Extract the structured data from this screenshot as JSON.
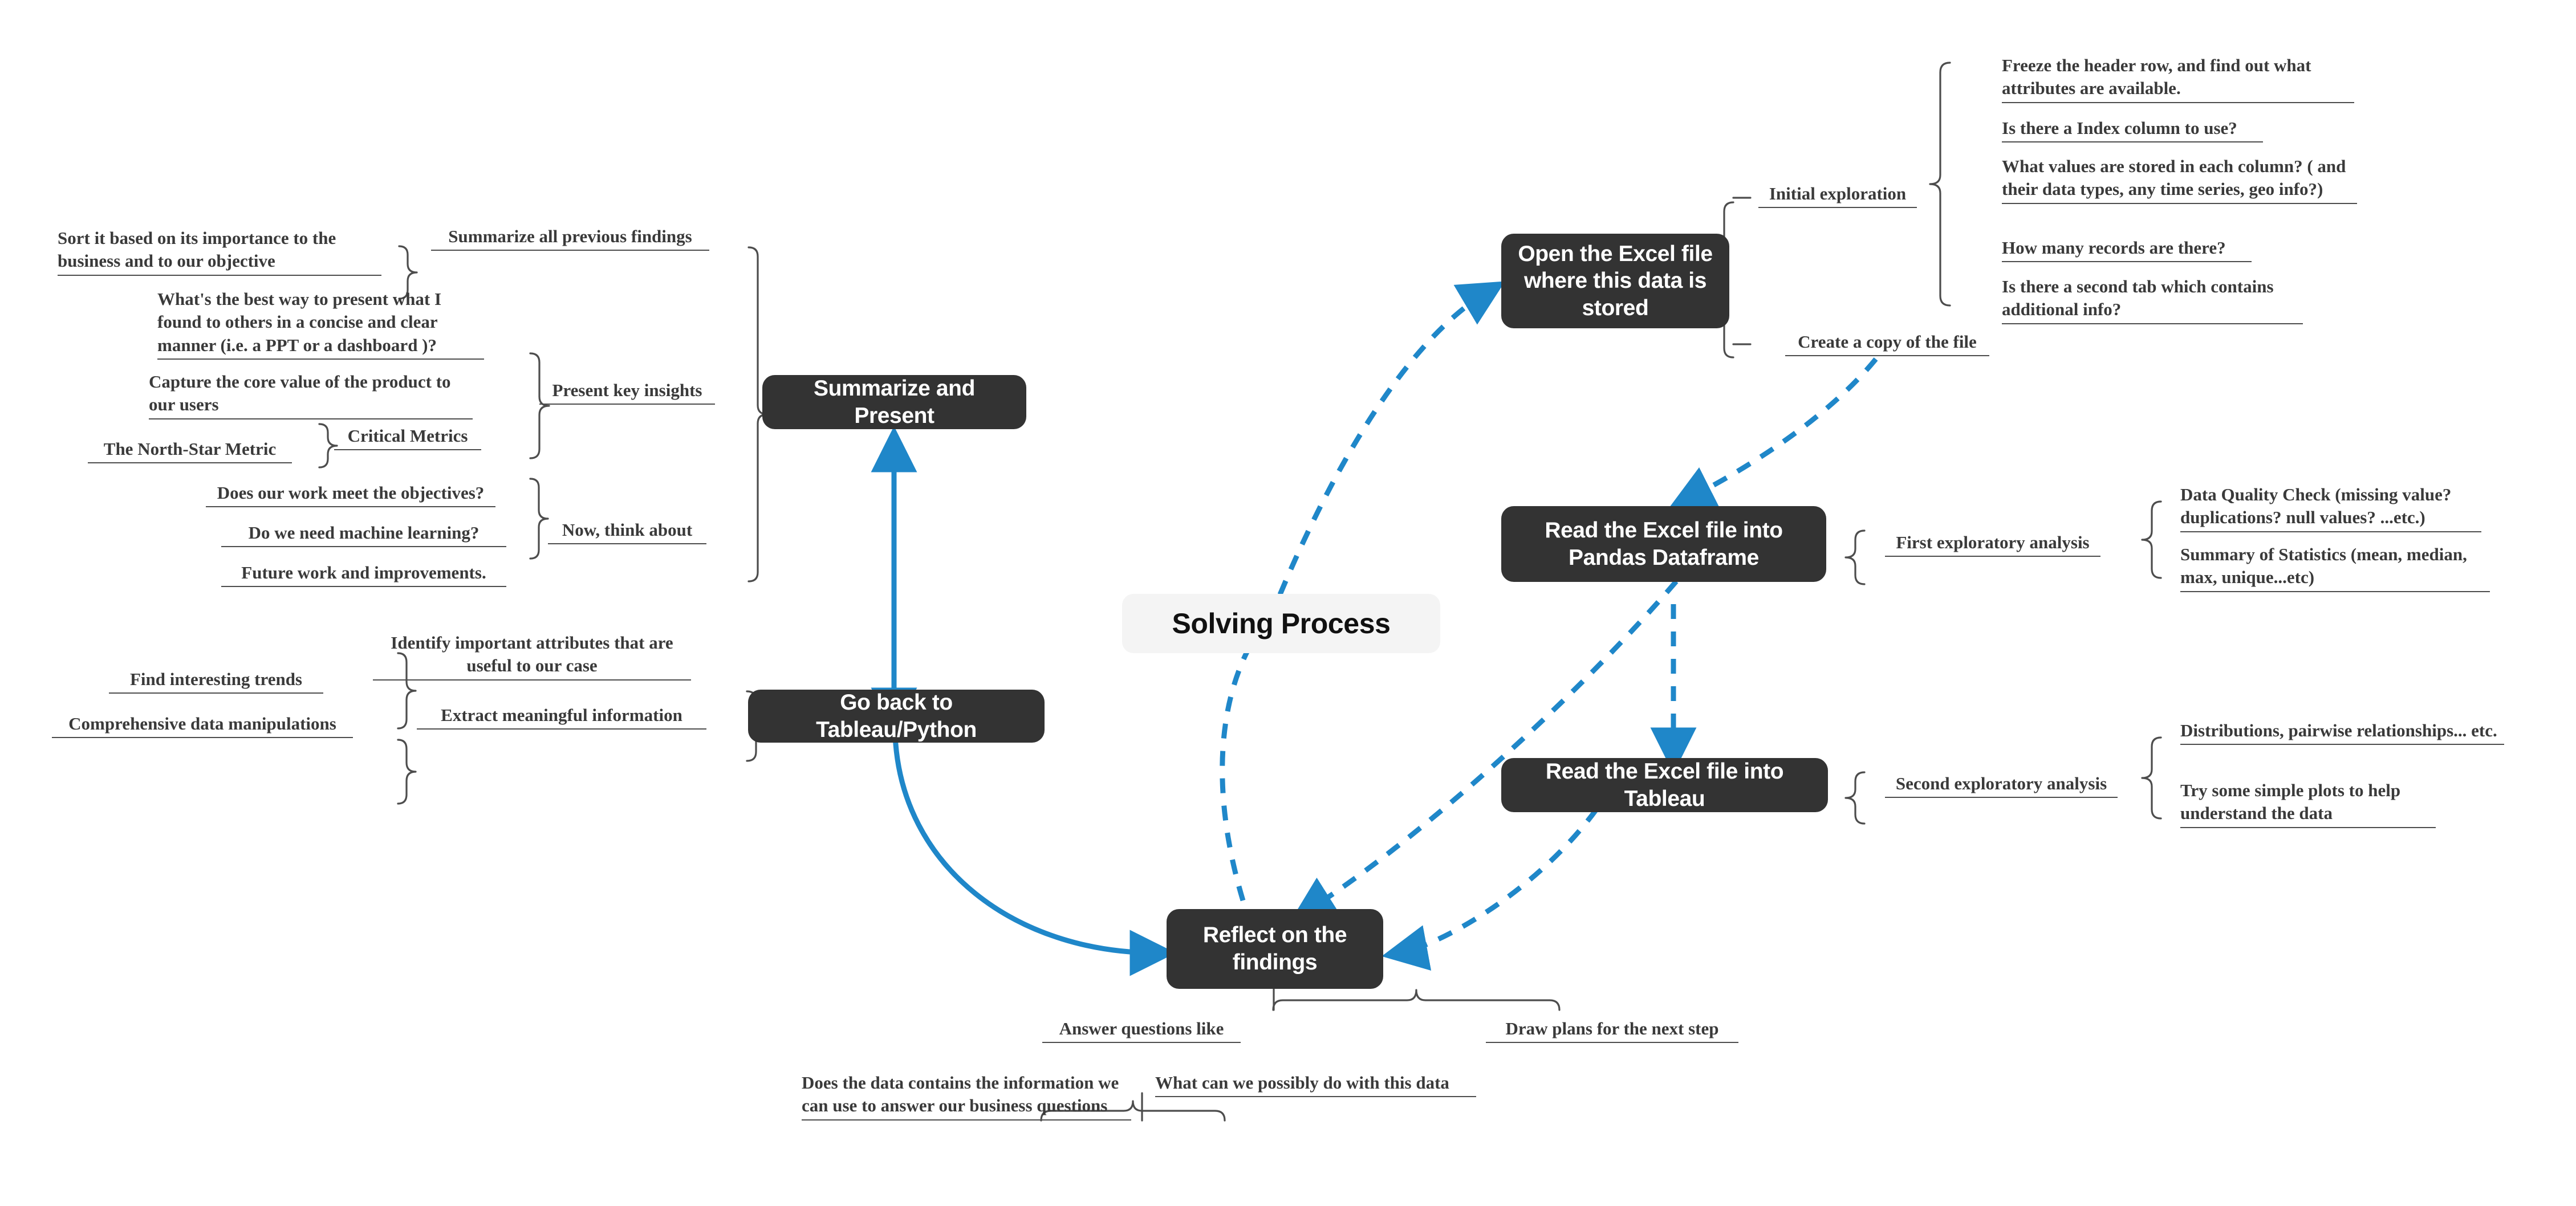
{
  "title": "Solving Process",
  "colors": {
    "node_fill": "#333333",
    "node_text": "#ffffff",
    "center_fill": "#f4f4f4",
    "center_text": "#111111",
    "accent_arrow": "#1f87c9",
    "line": "#4d4d4d",
    "background": "#ffffff"
  },
  "nodes": {
    "center": "Solving Process",
    "open_excel": "Open the Excel file where this data is stored",
    "read_pandas": "Read the Excel file into Pandas Dataframe",
    "read_tableau": "Read the Excel file into Tableau",
    "reflect": "Reflect on the findings",
    "go_back": "Go back to Tableau/Python",
    "summarize": "Summarize and Present"
  },
  "open_excel_branch": {
    "initial_exploration": "Initial exploration",
    "create_copy": "Create a copy of the file",
    "initial_exploration_items": [
      "Freeze the header row, and find out what attributes are available.",
      "Is there a Index column to use?",
      "What values are stored in each column? ( and their data types, any time series, geo info?)",
      "How many records are there?",
      "Is there a second tab which contains additional info?"
    ]
  },
  "pandas_branch": {
    "label": "First exploratory analysis",
    "items": [
      "Data Quality Check (missing value? duplications? null values? ...etc.)",
      "Summary of Statistics (mean, median, max, unique...etc)"
    ]
  },
  "tableau_branch": {
    "label": "Second exploratory analysis",
    "items": [
      "Distributions, pairwise relationships... etc.",
      "Try some simple plots to help understand the data"
    ]
  },
  "reflect_branch": {
    "answer_questions": "Answer questions like",
    "draw_plans": "Draw plans for the next step",
    "questions": [
      "Does the data contains the information we can use to answer our business questions",
      "What can we possibly do with this data"
    ]
  },
  "go_back_branch": {
    "identify_attributes": "Identify important attributes that are useful to our case",
    "extract_info": "Extract meaningful information",
    "find_trends": "Find interesting trends",
    "comprehensive": "Comprehensive data manipulations"
  },
  "summarize_branch": {
    "summarize_findings": "Summarize all previous findings",
    "present_insights": "Present key insights",
    "now_think_about": "Now, think about",
    "sort_importance": "Sort it based on its importance to the business and to our objective",
    "best_way_present": "What's the best way to present what I found to others in a concise and clear manner (i.e. a PPT or a dashboard )?",
    "capture_core_value": "Capture the core value of the product to our users",
    "critical_metrics": "Critical Metrics",
    "north_star": "The North-Star Metric",
    "meet_objectives": "Does our work meet the objectives?",
    "machine_learning": "Do we need machine learning?",
    "future_work": "Future work and improvements."
  }
}
